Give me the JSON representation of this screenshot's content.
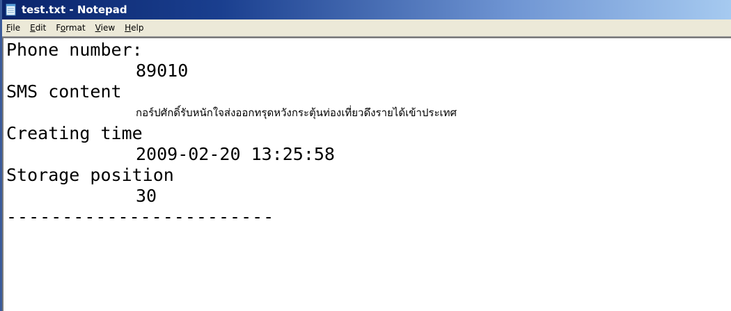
{
  "window": {
    "title": "test.txt - Notepad",
    "icon": "notepad-icon"
  },
  "menu": {
    "file": {
      "mnemonic": "F",
      "rest": "ile"
    },
    "edit": {
      "mnemonic": "E",
      "rest": "dit"
    },
    "format": {
      "pre": "F",
      "mnemonic": "o",
      "rest": "rmat"
    },
    "view": {
      "mnemonic": "V",
      "rest": "iew"
    },
    "help": {
      "mnemonic": "H",
      "rest": "elp"
    }
  },
  "content": {
    "phone_label": "Phone number:",
    "phone_value": "89010",
    "sms_label": "SMS content",
    "sms_value": "กอร์ปศักดิ์รับหนักใจส่งออกทรุดหวังกระตุ้นท่องเที่ยวดึงรายได้เข้าประเทศ",
    "time_label": "Creating time",
    "time_value": "2009-02-20 13:25:58",
    "storage_label": "Storage position",
    "storage_value": "30",
    "separator": "------------------------"
  }
}
